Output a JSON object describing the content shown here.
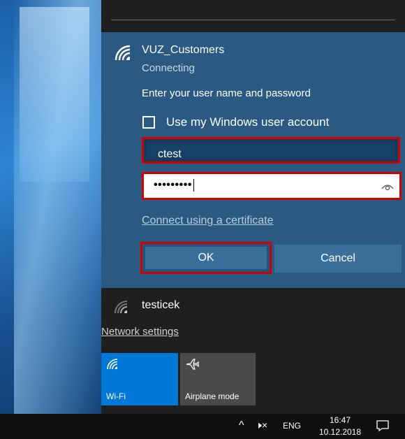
{
  "network": {
    "ssid": "VUZ_Customers",
    "status": "Connecting",
    "prompt": "Enter your user name and password",
    "windows_account_label": "Use my Windows user account",
    "windows_account_checked": false,
    "username_value": "ctest",
    "password_value": "•••••••••",
    "cert_link": "Connect using a certificate",
    "ok_label": "OK",
    "cancel_label": "Cancel"
  },
  "other_networks": [
    {
      "ssid": "testicek"
    }
  ],
  "network_settings_link": "Network settings",
  "quick_actions": [
    {
      "label": "Wi-Fi",
      "active": true,
      "color": "#0078d7",
      "icon": "wifi-icon"
    },
    {
      "label": "Airplane mode",
      "active": false,
      "color": "#4a4a4a",
      "icon": "airplane-icon"
    }
  ],
  "taskbar": {
    "tray_chevron": "^",
    "volume": "🕨×",
    "language": "ENG",
    "time": "16:47",
    "date": "10.12.2018"
  },
  "colors": {
    "highlight": "#d40000",
    "panel_accent": "#2a5a82",
    "tile_active": "#0078d7"
  }
}
